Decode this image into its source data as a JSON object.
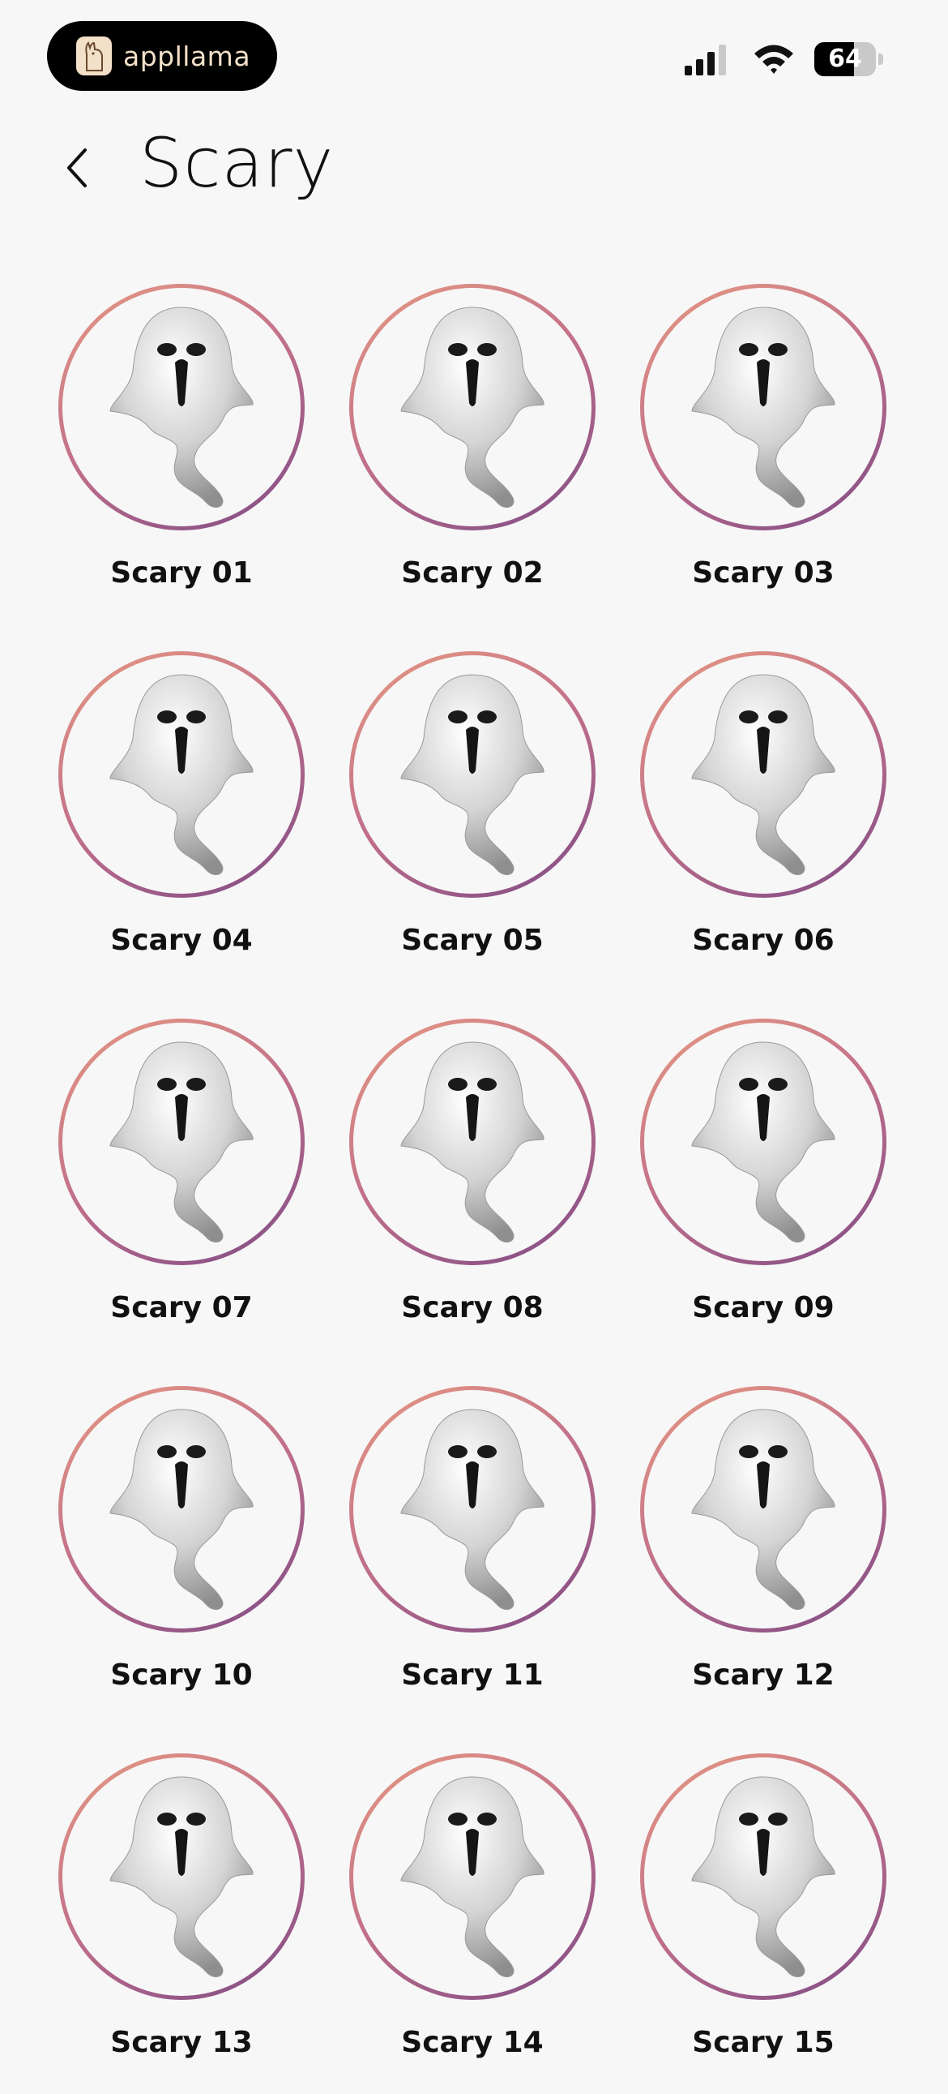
{
  "status_bar": {
    "brand_name": "appllama",
    "battery_level": "64",
    "battery_percent": 64,
    "signal_bars": 3,
    "icons": [
      "llama-logo-icon",
      "cellular-signal-icon",
      "wifi-icon",
      "battery-icon"
    ]
  },
  "header": {
    "title": "Scary",
    "back_icon": "chevron-left-icon"
  },
  "colors": {
    "background": "#f7f7f7",
    "ring_gradient_start": "#e89a82",
    "ring_gradient_end": "#7d4a86",
    "brand_text": "#f3e0c9"
  },
  "sounds": [
    {
      "label": "Scary 01",
      "icon": "ghost-icon"
    },
    {
      "label": "Scary 02",
      "icon": "ghost-icon"
    },
    {
      "label": "Scary 03",
      "icon": "ghost-icon"
    },
    {
      "label": "Scary 04",
      "icon": "ghost-icon"
    },
    {
      "label": "Scary 05",
      "icon": "ghost-icon"
    },
    {
      "label": "Scary 06",
      "icon": "ghost-icon"
    },
    {
      "label": "Scary 07",
      "icon": "ghost-icon"
    },
    {
      "label": "Scary 08",
      "icon": "ghost-icon"
    },
    {
      "label": "Scary 09",
      "icon": "ghost-icon"
    },
    {
      "label": "Scary 10",
      "icon": "ghost-icon"
    },
    {
      "label": "Scary 11",
      "icon": "ghost-icon"
    },
    {
      "label": "Scary 12",
      "icon": "ghost-icon"
    },
    {
      "label": "Scary 13",
      "icon": "ghost-icon"
    },
    {
      "label": "Scary 14",
      "icon": "ghost-icon"
    },
    {
      "label": "Scary 15",
      "icon": "ghost-icon"
    }
  ]
}
